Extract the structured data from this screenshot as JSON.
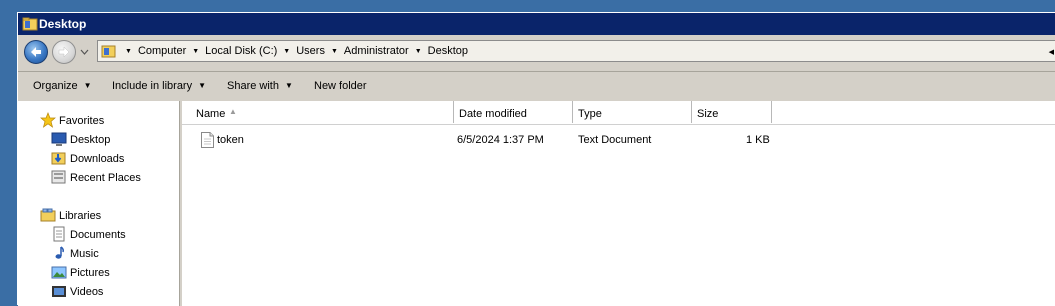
{
  "window": {
    "title": "Desktop"
  },
  "address": {
    "crumbs": [
      "Computer",
      "Local Disk (C:)",
      "Users",
      "Administrator",
      "Desktop"
    ]
  },
  "toolbar": {
    "organize": "Organize",
    "include_in_library": "Include in library",
    "share_with": "Share with",
    "new_folder": "New folder"
  },
  "nav": {
    "favorites": {
      "label": "Favorites",
      "items": [
        "Desktop",
        "Downloads",
        "Recent Places"
      ]
    },
    "libraries": {
      "label": "Libraries",
      "items": [
        "Documents",
        "Music",
        "Pictures",
        "Videos"
      ]
    }
  },
  "file_list": {
    "columns": [
      "Name",
      "Date modified",
      "Type",
      "Size"
    ],
    "sort_column": "Name",
    "rows": [
      {
        "name": "token",
        "date": "6/5/2024 1:37 PM",
        "type": "Text Document",
        "size": "1 KB",
        "icon": "text-file-icon"
      }
    ]
  },
  "colors": {
    "titlebar": "#0a246a",
    "desktop": "#3a6ea5",
    "chrome": "#d4d0c8"
  }
}
